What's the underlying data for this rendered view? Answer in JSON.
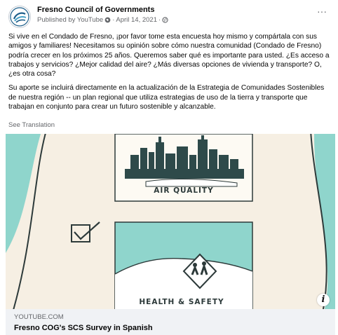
{
  "post": {
    "page_name": "Fresno Council of Governments",
    "publisher": "Published by YouTube",
    "date": "April 14, 2021",
    "separator": "·",
    "paragraphs": [
      "Si vive en el Condado de Fresno, ¡por favor tome esta encuesta hoy mismo y compártala con sus amigos y familiares! Necesitamos su opinión sobre cómo nuestra comunidad (Condado de Fresno) podría crecer en los próximos 25 años. Queremos saber qué es importante para usted. ¿Es acceso a trabajos y servicios? ¿Mejor calidad del aire? ¿Más diversas opciones de vivienda y transporte? O, ¿es otra cosa?",
      "Su aporte se incluirá directamente en la actualización de la Estrategia de Comunidades Sostenibles de nuestra región -- un plan regional que utiliza estrategias de uso de la tierra y transporte que trabajan en conjunto para crear un futuro sostenible y alcanzable."
    ],
    "see_translation": "See Translation",
    "more_label": "···"
  },
  "media": {
    "label_air": "AIR QUALITY",
    "label_health": "HEALTH & SAFETY",
    "info_label": "i"
  },
  "link": {
    "domain": "YOUTUBE.COM",
    "title": "Fresno COG's SCS Survey in Spanish"
  },
  "icons": {
    "avatar": "fresno-cog-logo",
    "verified": "globe-icon",
    "audience": "public-icon",
    "more": "more-options-icon",
    "info": "info-icon"
  },
  "colors": {
    "teal": "#8fd5cc",
    "skyline": "#2e4a4a",
    "cream": "#f6efe3",
    "link_bar": "#f0f2f5"
  }
}
